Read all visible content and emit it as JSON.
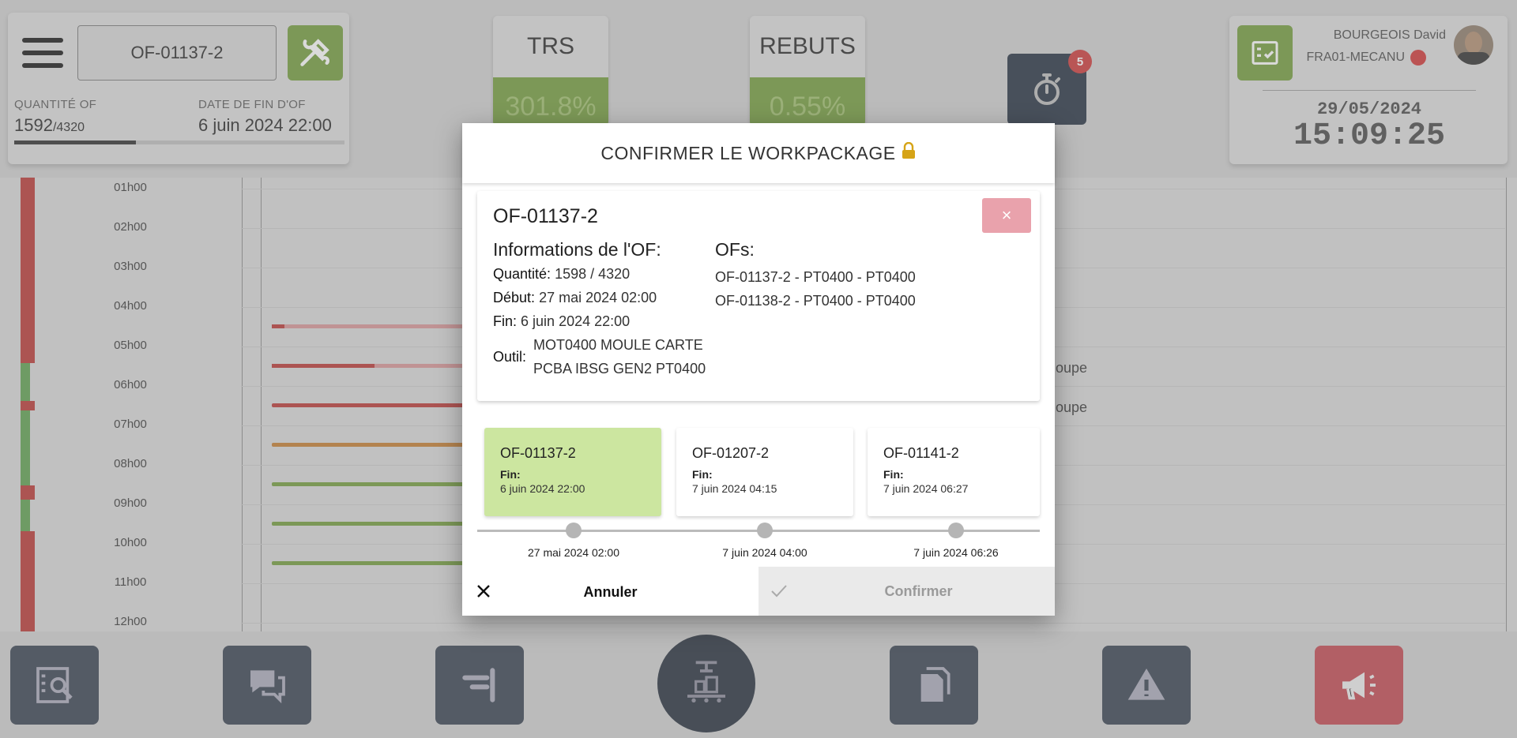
{
  "header": {
    "of_number": "OF-01137-2",
    "quantity_label": "QUANTITÉ OF",
    "quantity_value": "1592",
    "quantity_total": "/4320",
    "quantity_progress": 0.368,
    "end_date_label": "DATE DE FIN D'OF",
    "end_date_value": "6 juin 2024 22:00"
  },
  "kpis": {
    "trs_label": "TRS",
    "trs_value": "301.8%",
    "rebuts_label": "REBUTS",
    "rebuts_value": "0.55%"
  },
  "timer": {
    "badge": "5"
  },
  "user": {
    "name": "BOURGEOIS David",
    "site": "FRA01-MECANU",
    "status_color": "#d03030",
    "date": "29/05/2024",
    "time": "15:09:25"
  },
  "timeline": {
    "hours": [
      "01h00",
      "02h00",
      "03h00",
      "04h00",
      "05h00",
      "06h00",
      "07h00",
      "08h00",
      "09h00",
      "10h00",
      "11h00",
      "12h00"
    ],
    "bg_text_1": "oupe",
    "bg_text_2": "oupe"
  },
  "modal": {
    "title": "CONFIRMER LE WORKPACKAGE",
    "close_label": "×",
    "info": {
      "of_number": "OF-01137-2",
      "section_title": "Informations de l'OF:",
      "quantite_label": "Quantité:",
      "quantite_value": "1598 / 4320",
      "debut_label": "Début:",
      "debut_value": "27 mai 2024 02:00",
      "fin_label": "Fin:",
      "fin_value": "6 juin 2024 22:00",
      "outil_label": "Outil:",
      "outil_line1": "MOT0400 MOULE CARTE",
      "outil_line2": "PCBA IBSG GEN2 PT0400",
      "ofs_title": "OFs:",
      "ofs": [
        "OF-01137-2 - PT0400 - PT0400",
        "OF-01138-2 - PT0400 - PT0400"
      ]
    },
    "workpackages": [
      {
        "name": "OF-01137-2",
        "fin_label": "Fin:",
        "fin": "6 juin 2024 22:00",
        "selected": true
      },
      {
        "name": "OF-01207-2",
        "fin_label": "Fin:",
        "fin": "7 juin 2024 04:15",
        "selected": false
      },
      {
        "name": "OF-01141-2",
        "fin_label": "Fin:",
        "fin": "7 juin 2024 06:27",
        "selected": false
      }
    ],
    "slider_labels": [
      "27 mai 2024 02:00",
      "7 juin 2024 04:00",
      "7 juin 2024 06:26"
    ],
    "cancel_label": "Annuler",
    "confirm_label": "Confirmer"
  },
  "colors": {
    "brand_green": "#6f9a37",
    "selected_green": "#cce6a0",
    "dark_navy": "#1f2937",
    "alert_red": "#c2424c"
  },
  "icons": [
    "menu-icon",
    "wrench-hammer-icon",
    "stopwatch-icon",
    "checklist-icon",
    "avatar",
    "search-checklist-icon",
    "chat-icon",
    "align-right-icon",
    "conveyor-icon",
    "documents-icon",
    "warning-icon",
    "megaphone-icon",
    "close-icon",
    "check-icon",
    "lock-icon"
  ]
}
